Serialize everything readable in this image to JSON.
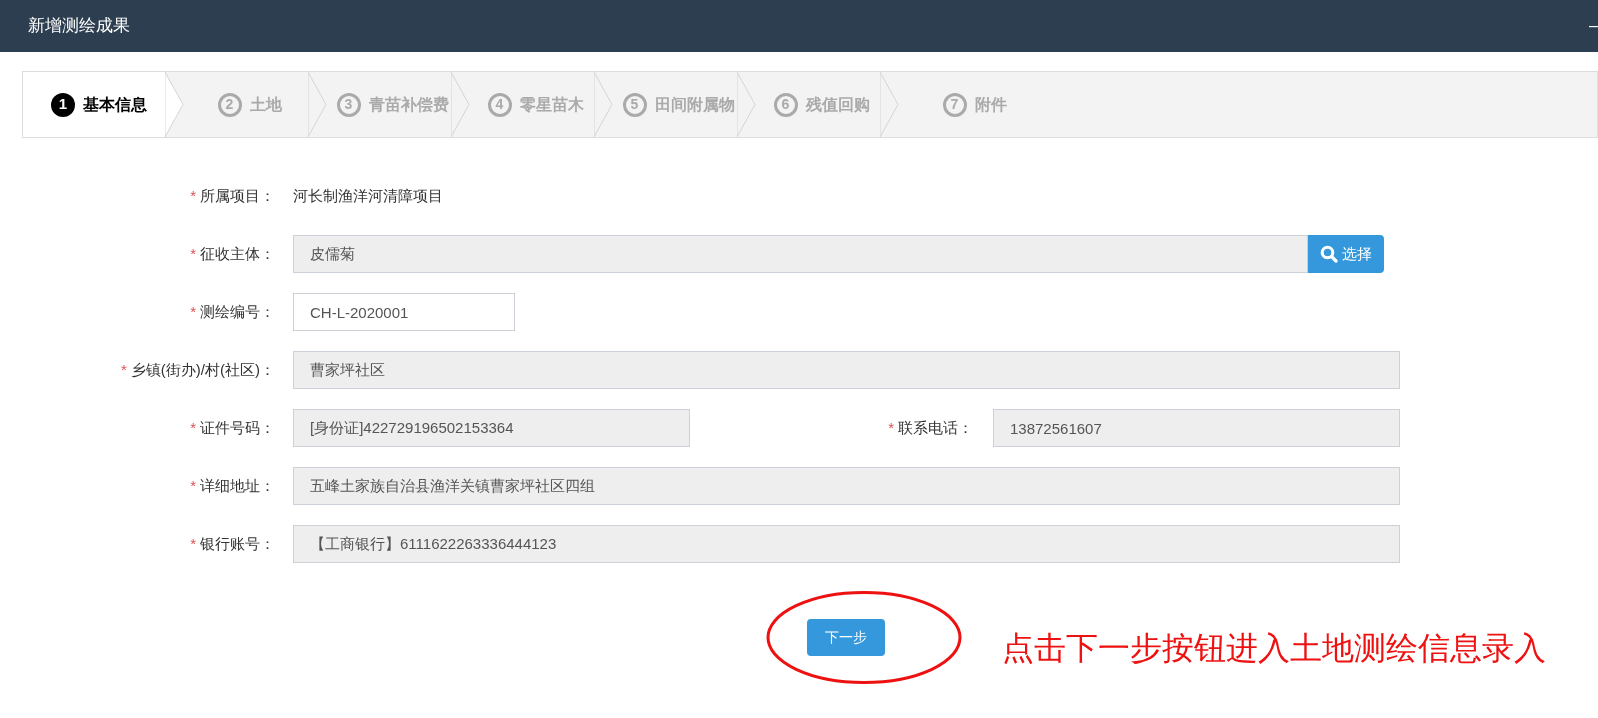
{
  "window": {
    "title": "新增测绘成果",
    "control": "–"
  },
  "steps": [
    {
      "number": "1",
      "label": "基本信息",
      "selected": true
    },
    {
      "number": "2",
      "label": "土地",
      "selected": false
    },
    {
      "number": "3",
      "label": "青苗补偿费",
      "selected": false
    },
    {
      "number": "4",
      "label": "零星苗木",
      "selected": false
    },
    {
      "number": "5",
      "label": "田间附属物",
      "selected": false
    },
    {
      "number": "6",
      "label": "残值回购",
      "selected": false
    },
    {
      "number": "7",
      "label": "附件",
      "selected": false
    }
  ],
  "form": [
    {
      "kind": "text",
      "required": "*",
      "label": "所属项目：",
      "value": "河长制渔洋河清障项目"
    },
    {
      "kind": "picker",
      "required": "*",
      "label": "征收主体：",
      "value": "皮儒菊",
      "button": "选择"
    },
    {
      "kind": "input",
      "required": "*",
      "label": "测绘编号：",
      "value": "CH-L-2020001"
    },
    {
      "kind": "readonly",
      "required": "*",
      "label": "乡镇(街办)/村(社区)：",
      "value": "曹家坪社区"
    },
    {
      "kind": "pair",
      "required": "*",
      "label": "证件号码：",
      "value": "[身份证]422729196502153364",
      "second": {
        "required": "*",
        "label": "联系电话：",
        "value": "13872561607"
      }
    },
    {
      "kind": "readonly",
      "required": "*",
      "label": "详细地址：",
      "value": "五峰土家族自治县渔洋关镇曹家坪社区四组"
    },
    {
      "kind": "readonly",
      "required": "*",
      "label": "银行账号：",
      "value": "【工商银行】6111622263336444123"
    }
  ],
  "next_button": "下一步",
  "annotation": "点击下一步按钮进入土地测绘信息录入"
}
